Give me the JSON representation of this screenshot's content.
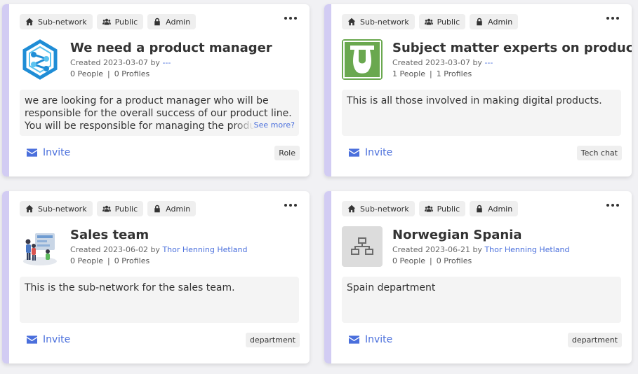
{
  "cards": [
    {
      "badges": {
        "subnetwork": "Sub-network",
        "public": "Public",
        "admin": "Admin"
      },
      "title": "We need a product manager",
      "created": "Created 2023-03-07 by ",
      "author": "---",
      "people": "0 People",
      "divider": "|",
      "profiles": "0 Profiles",
      "description": "we are looking for a product manager who will be responsible for the overall success of our product line. You will be responsible for managing the product",
      "see_more": "See more?",
      "invite": "Invite",
      "tag": "Role",
      "logo_icon": "hexagon-network-logo"
    },
    {
      "badges": {
        "subnetwork": "Sub-network",
        "public": "Public",
        "admin": "Admin"
      },
      "title": "Subject matter experts on products",
      "created": "Created 2023-03-07 by ",
      "author": "---",
      "people": "1 People",
      "divider": "|",
      "profiles": "1 Profiles",
      "description": "This is all those involved in making digital products.",
      "invite": "Invite",
      "tag": "Tech chat",
      "logo_icon": "green-vase-logo"
    },
    {
      "badges": {
        "subnetwork": "Sub-network",
        "public": "Public",
        "admin": "Admin"
      },
      "title": "Sales team",
      "created": "Created 2023-06-02 by ",
      "author": "Thor Henning Hetland",
      "people": "0 People",
      "divider": "|",
      "profiles": "0 Profiles",
      "description": "This is the sub-network for the sales team.",
      "invite": "Invite",
      "tag": "department",
      "logo_icon": "team-illustration-logo"
    },
    {
      "badges": {
        "subnetwork": "Sub-network",
        "public": "Public",
        "admin": "Admin"
      },
      "title": "Norwegian Spania",
      "created": "Created 2023-06-21 by ",
      "author": "Thor Henning Hetland",
      "people": "0 People",
      "divider": "|",
      "profiles": "0 Profiles",
      "description": "Spain department",
      "invite": "Invite",
      "tag": "department",
      "logo_icon": "network-placeholder-icon"
    }
  ],
  "colors": {
    "accent": "#4a6fdc",
    "stripe": "#d2ccf3",
    "logo_green": "#6aa84f",
    "logo_blue": "#1f8dd6"
  }
}
